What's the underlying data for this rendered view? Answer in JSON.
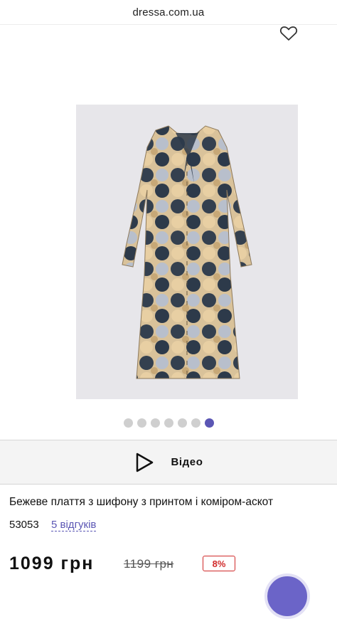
{
  "browser": {
    "url": "dressa.com.ua"
  },
  "icons": {
    "favorite": "heart-outline-icon",
    "video": "play-triangle-icon"
  },
  "gallery": {
    "total_slides": 7,
    "active_index": 6
  },
  "video_button": {
    "label": "Відео"
  },
  "product": {
    "title": "Бежеве плаття з шифону з принтом і коміром-аскот",
    "code": "53053",
    "reviews_label": "5 відгуків",
    "price": "1099 грн",
    "old_price": "1199 грн",
    "discount": "8%"
  },
  "colors": {
    "accent": "#5b56b4",
    "discount": "#d02a2a"
  }
}
